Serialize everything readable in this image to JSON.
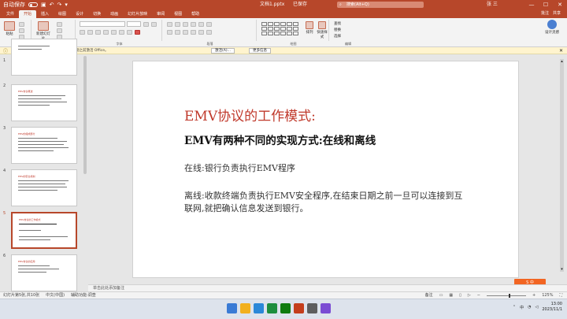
{
  "titlebar": {
    "autosave": "自动保存",
    "doc_title": "文档1.pptx",
    "status": "已保存",
    "search_placeholder": "搜索(Alt+Q)",
    "user": "张 三",
    "minimize": "—",
    "maximize": "☐",
    "close": "✕"
  },
  "tabs": [
    "文件",
    "开始",
    "插入",
    "绘图",
    "设计",
    "切换",
    "动画",
    "幻灯片放映",
    "审阅",
    "视图",
    "帮助"
  ],
  "tab_actions": {
    "comment": "批注",
    "share": "共享"
  },
  "ribbon": {
    "groups": [
      "剪贴板",
      "幻灯片",
      "字体",
      "段落",
      "绘图",
      "编辑",
      "设计器"
    ],
    "paste": "粘贴",
    "new_slide": "新建幻灯片",
    "arrange": "排列",
    "quick_styles": "快速样式",
    "find": "查找",
    "replace": "替换",
    "select": "选择",
    "designer": "设计灵感"
  },
  "notify": {
    "title": "产品激活失败",
    "text": "为避免中断使用,请在此日期之前激活 Office。",
    "btn1": "激活(A)...",
    "btn2": "更多信息",
    "close": "✕"
  },
  "thumbnails": [
    {
      "num": "1",
      "title": ""
    },
    {
      "num": "2",
      "title": "EMV协议概述"
    },
    {
      "num": "3",
      "title": "EMV的组成部分"
    },
    {
      "num": "4",
      "title": "EMV的安全机制"
    },
    {
      "num": "5",
      "title": "EMV协议的工作模式"
    },
    {
      "num": "6",
      "title": "EMV协议的应用"
    }
  ],
  "slide": {
    "title": "EMV协议的工作模式:",
    "subtitle": "EMV有两种不同的实现方式:在线和离线",
    "para1": "在线:银行负责执行EMV程序",
    "para2": "离线:收款终端负责执行EMV安全程序,在结束日期之前一旦可以连接到互联网,就把确认信息发送到银行。"
  },
  "watermark": "S 中",
  "notes": "单击此处添加备注",
  "statusbar": {
    "slide_info": "幻灯片第5张,共10张",
    "language": "中文(中国)",
    "accessibility": "辅助功能:调查",
    "notes_btn": "备注",
    "zoom": "125%"
  },
  "taskbar": {
    "time": "13:00",
    "date": "2023/11/1",
    "lang": "中",
    "icon_colors": [
      "#3a7bd5",
      "#f2b01e",
      "#2b88d8",
      "#1e8e3e",
      "#0f7b0f",
      "#c43e1c",
      "#5e5e5e",
      "#7a4bd3"
    ]
  },
  "colors": {
    "brand": "#b7472a",
    "slide_title": "#c0392b"
  }
}
